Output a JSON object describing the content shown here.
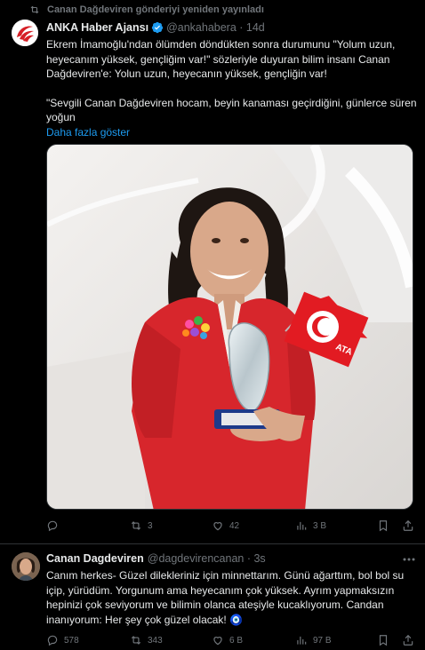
{
  "repost": {
    "icon": "repost-icon",
    "text": "Canan Dağdeviren gönderiyi yeniden yayınladı"
  },
  "tweet1": {
    "name": "ANKA Haber Ajansı",
    "handle": "@ankahabera",
    "sep": " · ",
    "time": "14d",
    "text1": "Ekrem İmamoğlu'ndan ölümden döndükten sonra durumunu \"Yolum uzun, heyecanım yüksek, gençliğim var!\" sözleriyle duyuran bilim insanı Canan Dağdeviren'e: Yolun uzun, heyecanın yüksek, gençliğin var!",
    "text2": "\"Sevgili Canan Dağdeviren hocam, beyin kanaması geçirdiğini, günlerce süren yoğun",
    "show_more": "Daha fazla göster",
    "flag_text": "ATA",
    "replies": "",
    "reposts": "3",
    "likes": "42",
    "views": "3 B"
  },
  "tweet2": {
    "name": "Canan Dagdeviren",
    "handle": "@dagdevirencanan",
    "sep": " · ",
    "time": "3s",
    "text": "Canım herkes- Güzel dilekleriniz için minnettarım. Günü ağarttım, bol bol su içip, yürüdüm. Yorgunum ama heyecanım çok yüksek. Ayrım yapmaksızın hepinizi çok seviyorum ve bilimin olanca ateşiyle kucaklıyorum. Candan inanıyorum: Her şey çok güzel olacak! 🧿",
    "replies": "578",
    "reposts": "343",
    "likes": "6 B",
    "views": "97 B"
  },
  "colors": {
    "accent": "#1d9bf0",
    "muted": "#71767b",
    "text": "#e7e9ea",
    "bg": "#000000",
    "logo_red": "#d61f26"
  }
}
